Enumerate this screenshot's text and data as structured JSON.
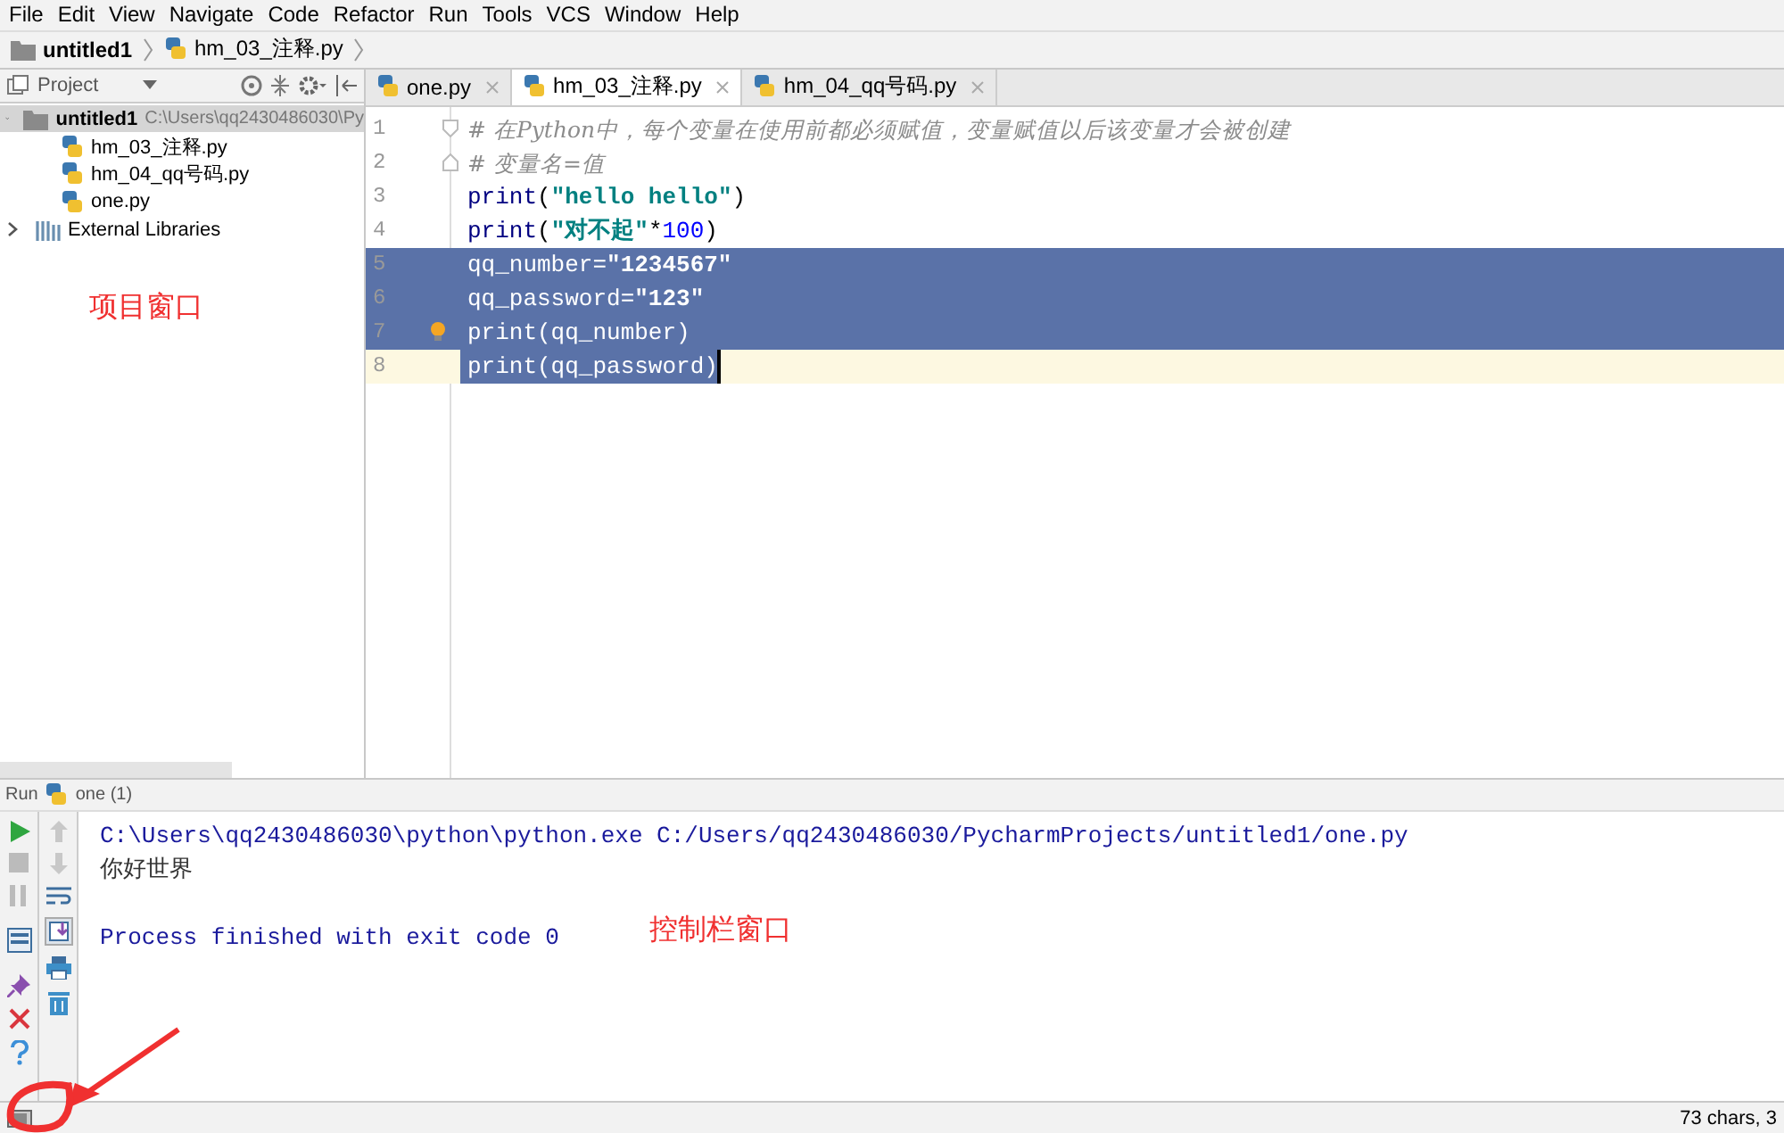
{
  "menu": [
    "File",
    "Edit",
    "View",
    "Navigate",
    "Code",
    "Refactor",
    "Run",
    "Tools",
    "VCS",
    "Window",
    "Help"
  ],
  "breadcrumb": [
    "untitled1",
    "hm_03_注释.py"
  ],
  "project_panel": {
    "title": "Project",
    "annotation": "项目窗口",
    "tree": [
      {
        "label": "untitled1",
        "path": "C:\\Users\\qq2430486030\\Py",
        "kind": "folder",
        "expanded": true,
        "selected": true,
        "children": [
          {
            "label": "hm_03_注释.py",
            "kind": "python",
            "selected": false
          },
          {
            "label": "hm_04_qq号码.py",
            "kind": "python",
            "selected": false
          },
          {
            "label": "one.py",
            "kind": "python",
            "selected": false
          }
        ]
      },
      {
        "label": "External Libraries",
        "kind": "libraries",
        "expanded": false,
        "selected": false
      }
    ]
  },
  "editor": {
    "tabs": [
      {
        "label": "one.py",
        "selected": false
      },
      {
        "label": "hm_03_注释.py",
        "selected": true
      },
      {
        "label": "hm_04_qq号码.py",
        "selected": false
      }
    ],
    "lines": [
      {
        "number": "1",
        "fold": true,
        "selected": false,
        "current": false,
        "bulb": false,
        "segments": [
          {
            "kind": "comment",
            "text": "# 在Python中，每个变量在使用前都必须赋值，变量赋值以后该变量才会被创建"
          }
        ]
      },
      {
        "number": "2",
        "fold": true,
        "selected": false,
        "current": false,
        "bulb": false,
        "segments": [
          {
            "kind": "comment",
            "text": "# 变量名=值"
          }
        ]
      },
      {
        "number": "3",
        "fold": false,
        "selected": false,
        "current": false,
        "bulb": false,
        "segments": [
          {
            "kind": "builtin",
            "text": "print"
          },
          {
            "kind": "plain",
            "text": "("
          },
          {
            "kind": "string",
            "text": "\"hello hello\""
          },
          {
            "kind": "plain",
            "text": ")"
          }
        ]
      },
      {
        "number": "4",
        "fold": false,
        "selected": false,
        "current": false,
        "bulb": false,
        "segments": [
          {
            "kind": "builtin",
            "text": "print"
          },
          {
            "kind": "plain",
            "text": "("
          },
          {
            "kind": "string",
            "text": "\"对不起\""
          },
          {
            "kind": "plain",
            "text": "*"
          },
          {
            "kind": "number",
            "text": "100"
          },
          {
            "kind": "plain",
            "text": ")"
          }
        ]
      },
      {
        "number": "5",
        "fold": false,
        "selected": true,
        "current": false,
        "bulb": false,
        "segments": [
          {
            "kind": "plain",
            "text": "qq_number="
          },
          {
            "kind": "string",
            "text": "\"1234567\""
          }
        ]
      },
      {
        "number": "6",
        "fold": false,
        "selected": true,
        "current": false,
        "bulb": false,
        "segments": [
          {
            "kind": "plain",
            "text": "qq_password="
          },
          {
            "kind": "string",
            "text": "\"123\""
          }
        ]
      },
      {
        "number": "7",
        "fold": false,
        "selected": true,
        "current": false,
        "bulb": true,
        "segments": [
          {
            "kind": "plain",
            "text": "print(qq_number)"
          }
        ]
      },
      {
        "number": "8",
        "fold": false,
        "selected": true,
        "current": true,
        "bulb": false,
        "segments": [
          {
            "kind": "plain",
            "text": "print(qq_password)"
          }
        ]
      }
    ]
  },
  "run_panel": {
    "title": "Run",
    "config": "one (1)",
    "annotation": "控制栏窗口",
    "output": [
      {
        "kind": "command",
        "text": "C:\\Users\\qq2430486030\\python\\python.exe C:/Users/qq2430486030/PycharmProjects/untitled1/one.py"
      },
      {
        "kind": "stdout",
        "text": "你好世界"
      },
      {
        "kind": "exit",
        "text": "Process finished with exit code 0"
      }
    ]
  },
  "status_bar": {
    "text": "73 chars, 3"
  }
}
